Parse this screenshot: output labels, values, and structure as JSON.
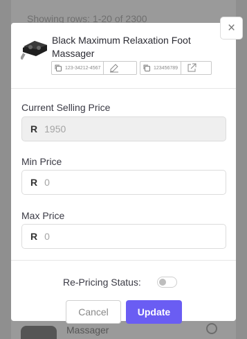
{
  "background": {
    "rows_text": "Showing rows: 1-20 of 2300",
    "row_product_fragment": "Massager"
  },
  "modal": {
    "close_glyph": "×",
    "product": {
      "title": "Black Maximum Relaxation Foot Massager",
      "sku_code": "123-34212-4567",
      "id_code": "123456789"
    },
    "fields": {
      "current_selling_price": {
        "label": "Current Selling Price",
        "currency": "R",
        "value": "1950"
      },
      "min_price": {
        "label": "Min Price",
        "currency": "R",
        "placeholder": "0"
      },
      "max_price": {
        "label": "Max Price",
        "currency": "R",
        "placeholder": "0"
      }
    },
    "repricing": {
      "label": "Re-Pricing Status:",
      "enabled": false
    },
    "buttons": {
      "cancel": "Cancel",
      "update": "Update"
    }
  },
  "colors": {
    "accent": "#6a5df3",
    "overlay": "#8f8f8f",
    "disabled_field": "#efefef"
  }
}
